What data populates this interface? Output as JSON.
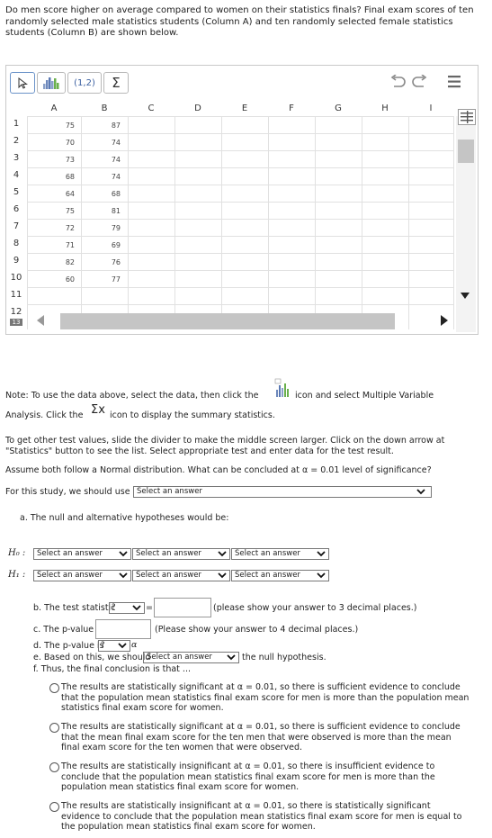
{
  "question": "Do men score higher on average compared to women on their statistics finals? Final exam scores of ten randomly selected male statistics students (Column A) and ten randomly selected female statistics students (Column B) are shown below.",
  "toolbar": {
    "pointer_icon": "cursor-arrow-icon",
    "chart_icon": "bar-chart-icon",
    "pair_label": "(1,2)",
    "sum_label": "Σ",
    "undo_icon": "undo-icon",
    "redo_icon": "redo-icon",
    "menu_icon": "hamburger-menu-icon"
  },
  "columns": [
    "A",
    "B",
    "C",
    "D",
    "E",
    "F",
    "G",
    "H",
    "I"
  ],
  "rows": [
    "1",
    "2",
    "3",
    "4",
    "5",
    "6",
    "7",
    "8",
    "9",
    "10",
    "11",
    "12",
    "13"
  ],
  "colA": [
    "75",
    "70",
    "73",
    "68",
    "64",
    "75",
    "72",
    "71",
    "82",
    "60"
  ],
  "colB": [
    "87",
    "74",
    "74",
    "74",
    "68",
    "81",
    "79",
    "69",
    "76",
    "77"
  ],
  "note1a": "Note: To use the data above, select the data, then click the",
  "note1b": "icon and select Multiple Variable",
  "note2a": "Analysis.  Click the",
  "note2_sigma": "Σx",
  "note2b": "icon to display the summary statistics.",
  "note3": "To get other test values, slide the divider to make the middle screen larger. Click on the down arrow at \"Statistics\" button to see the list. Select appropriate test and enter data for the test result.",
  "assume": "Assume both follow a Normal distribution.  What can be concluded at  α = 0.01 level of significance?",
  "use_label": "For this study, we should use",
  "select_answer": "Select an answer",
  "select_short": "Select an answer",
  "part_a": "a. The null and alternative hypotheses would be:",
  "h0": "H₀ :",
  "h1": "H₁ :",
  "equals": "=",
  "part_b": "b. The test statistic",
  "q": "?",
  "part_b_hint": "(please show your answer to 3 decimal places.)",
  "part_c": "c. The p-value =",
  "part_c_hint": "(Please show your answer to 4 decimal places.)",
  "part_d": "d. The p-value is",
  "alpha": "α",
  "part_e": "e. Based on this, we should",
  "part_e_tail": "the null hypothesis.",
  "part_f": "f. Thus, the final conclusion is that ...",
  "options": [
    [
      "The results are statistically significant at α = 0.01, so there is sufficient evidence to conclude",
      "that the population mean statistics final exam score for men is more than the population mean",
      "statistics final exam score for women."
    ],
    [
      "The results are statistically significant at α = 0.01, so there is sufficient evidence to conclude",
      "that the mean final exam score for the ten men that were observed is more than the mean",
      "final exam score for the ten women that were observed."
    ],
    [
      "The results are statistically insignificant at α = 0.01, so there is insufficient evidence to",
      "conclude that the population mean statistics final exam score for men is more than the",
      "population mean statistics final exam score for women."
    ],
    [
      "The results are statistically insignificant at α = 0.01, so there is statistically significant",
      "evidence to conclude that the population mean statistics final exam score for men is equal to",
      "the population mean statistics final exam score for women."
    ]
  ]
}
